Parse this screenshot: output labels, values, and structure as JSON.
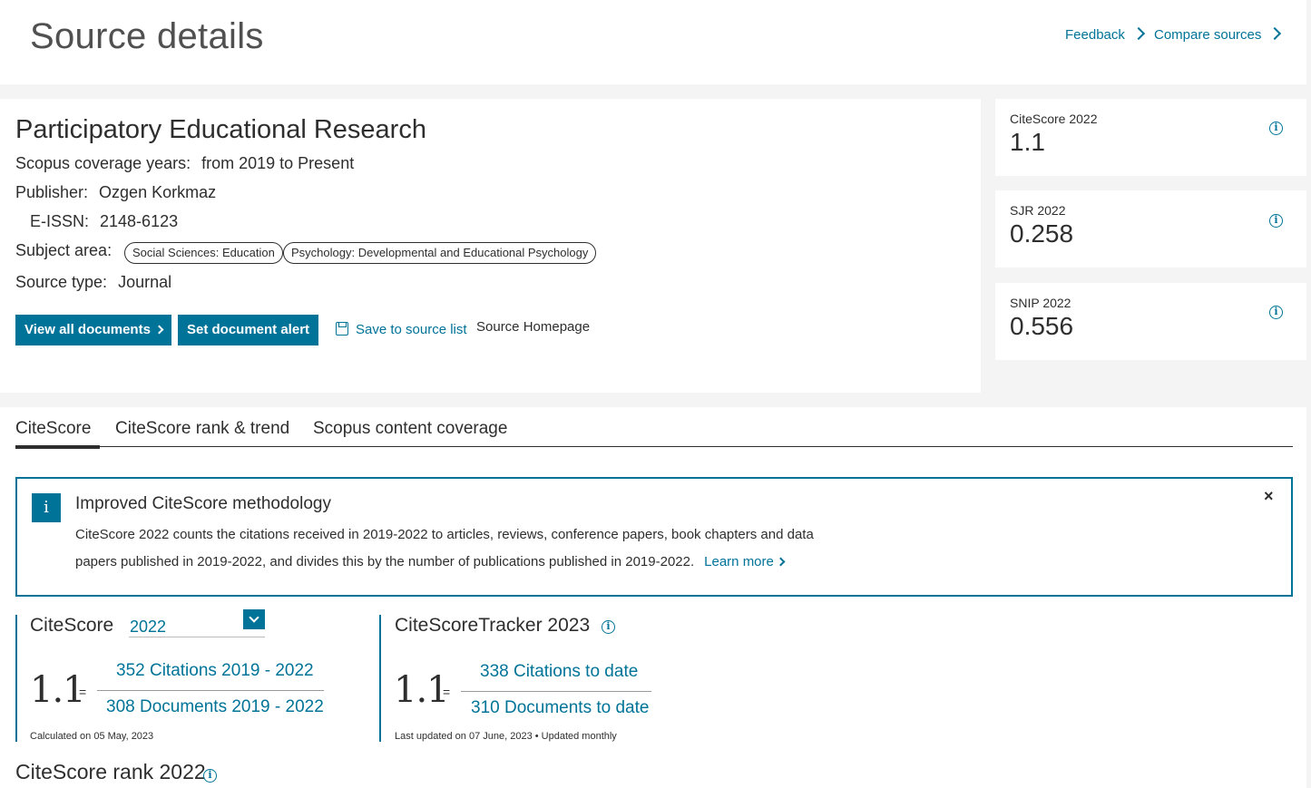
{
  "header": {
    "title": "Source details",
    "feedback_label": "Feedback",
    "compare_label": "Compare sources"
  },
  "source": {
    "title": "Participatory Educational Research",
    "coverage_label": "Scopus coverage years:",
    "coverage_value": "from 2019 to Present",
    "publisher_label": "Publisher:",
    "publisher_value": "Ozgen Korkmaz",
    "eissn_label": "E-ISSN:",
    "eissn_value": "2148-6123",
    "subject_label": "Subject area:",
    "subjects": [
      "Social Sciences: Education",
      "Psychology: Developmental and Educational Psychology"
    ],
    "type_label": "Source type:",
    "type_value": "Journal"
  },
  "actions": {
    "view_all": "View all documents",
    "set_alert": "Set document alert",
    "save_source": "Save to source list",
    "homepage": "Source Homepage"
  },
  "metrics": [
    {
      "label": "CiteScore 2022",
      "value": "1.1"
    },
    {
      "label": "SJR 2022",
      "value": "0.258"
    },
    {
      "label": "SNIP 2022",
      "value": "0.556"
    }
  ],
  "tabs": [
    "CiteScore",
    "CiteScore rank & trend",
    "Scopus content coverage"
  ],
  "notice": {
    "icon": "i",
    "title": "Improved CiteScore methodology",
    "line1": "CiteScore 2022 counts the citations received in 2019-2022 to articles, reviews, conference papers, book chapters and data",
    "line2": "papers published in 2019-2022, and divides this by the number of publications published in 2019-2022.",
    "learn_more": "Learn more",
    "close": "×"
  },
  "citescore": {
    "title": "CiteScore",
    "year": "2022",
    "value": "1.1",
    "eq": "=",
    "numerator": "352 Citations 2019 - 2022",
    "denominator": "308 Documents 2019 - 2022",
    "calculated": "Calculated on 05 May, 2023"
  },
  "tracker": {
    "title": "CiteScoreTracker 2023",
    "value": "1.1",
    "eq": "=",
    "numerator": "338 Citations to date",
    "denominator": "310 Documents to date",
    "updated": "Last updated on 07 June, 2023 • Updated monthly"
  },
  "rank": {
    "title": "CiteScore rank 2022"
  },
  "colors": {
    "accent": "#007398",
    "text": "#2e2e2e",
    "background": "#f4f4f4"
  }
}
